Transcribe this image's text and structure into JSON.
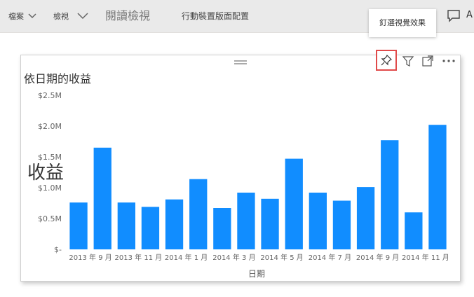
{
  "toolbar": {
    "file_label": "檔案",
    "view_label": "檢視",
    "reading_view_label": "閱讀檢視",
    "mobile_layout_label": "行動裝置版面配置",
    "overflow_initial": "A"
  },
  "tooltip": {
    "pin_visual": "釘選視覺效果"
  },
  "colors": {
    "bar": "#118dff",
    "topbar": "#eaeaea",
    "pin_highlight": "#e04a4a"
  },
  "icons": [
    "chevron-down-icon",
    "comment-icon",
    "drag-grip-icon",
    "pin-icon",
    "filter-icon",
    "focus-mode-icon",
    "more-options-icon"
  ],
  "chart_data": {
    "type": "bar",
    "title": "依日期的收益",
    "xlabel": "日期",
    "ylabel": "收益",
    "y_tick_labels": [
      "$-",
      "$0.5M",
      "$1.0M",
      "$1.5M",
      "$2.0M",
      "$2.5M"
    ],
    "x_tick_labels": [
      "2013 年 9 月",
      "2013 年 11 月",
      "2014 年 1 月",
      "2014 年 3 月",
      "2014 年 5 月",
      "2014 年 7 月",
      "2014 年 9 月",
      "2014 年 11 月"
    ],
    "ylim": [
      0,
      2.5
    ],
    "grid": false,
    "values": [
      0.76,
      1.65,
      0.76,
      0.69,
      0.81,
      1.14,
      0.67,
      0.92,
      0.82,
      1.47,
      0.92,
      0.79,
      1.01,
      1.77,
      0.6,
      2.02
    ]
  }
}
